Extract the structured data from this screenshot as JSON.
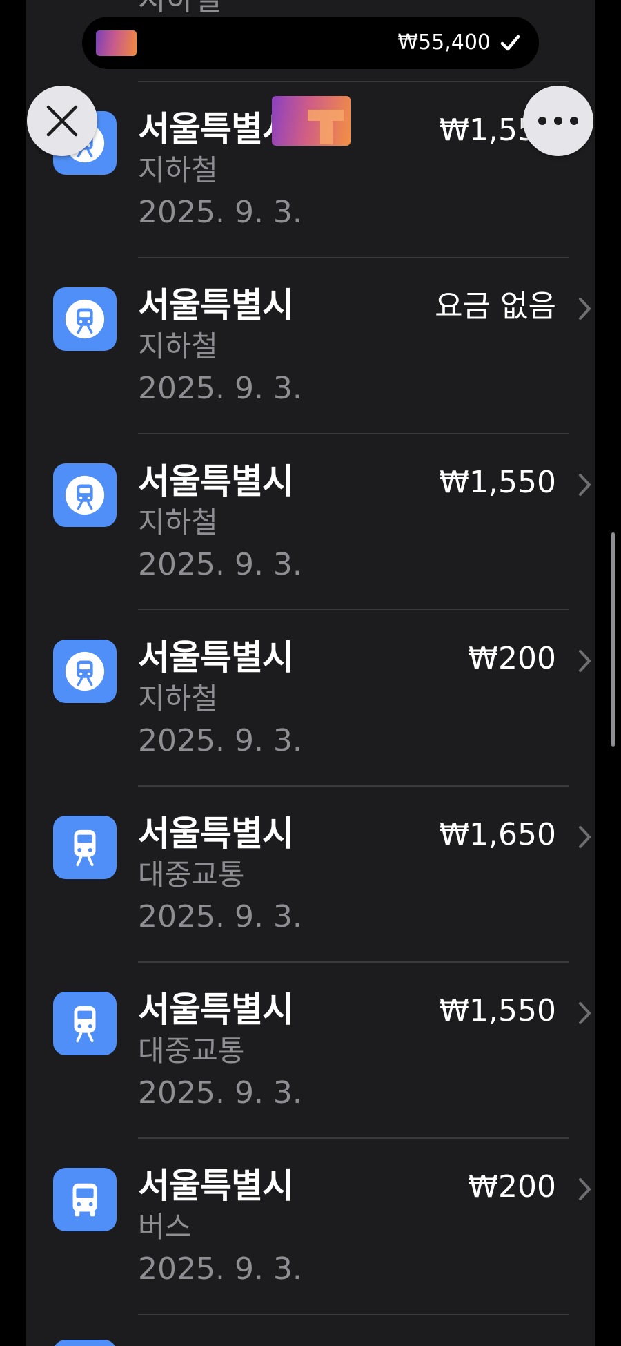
{
  "summary": {
    "amount": "₩55,400",
    "status_icon": "checkmark-icon"
  },
  "clipped_top_text": "지하철",
  "transactions": [
    {
      "merchant": "서울특별시",
      "category": "지하철",
      "date": "2025. 9. 3.",
      "amount": "₩1,550",
      "icon": "subway-icon"
    },
    {
      "merchant": "서울특별시",
      "category": "지하철",
      "date": "2025. 9. 3.",
      "amount": "요금 없음",
      "icon": "subway-icon"
    },
    {
      "merchant": "서울특별시",
      "category": "지하철",
      "date": "2025. 9. 3.",
      "amount": "₩1,550",
      "icon": "subway-icon"
    },
    {
      "merchant": "서울특별시",
      "category": "지하철",
      "date": "2025. 9. 3.",
      "amount": "₩200",
      "icon": "subway-icon"
    },
    {
      "merchant": "서울특별시",
      "category": "대중교통",
      "date": "2025. 9. 3.",
      "amount": "₩1,650",
      "icon": "train-icon"
    },
    {
      "merchant": "서울특별시",
      "category": "대중교통",
      "date": "2025. 9. 3.",
      "amount": "₩1,550",
      "icon": "train-icon"
    },
    {
      "merchant": "서울특별시",
      "category": "버스",
      "date": "2025. 9. 3.",
      "amount": "₩200",
      "icon": "bus-icon"
    }
  ],
  "colors": {
    "accent": "#4f8ff7",
    "background": "#1c1c1e",
    "secondary_text": "#8e8e93"
  }
}
